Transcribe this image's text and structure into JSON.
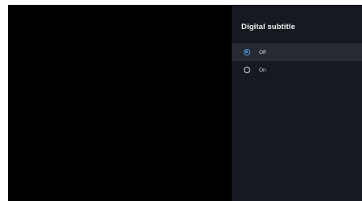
{
  "panel": {
    "title": "Digital subtitle",
    "options": [
      {
        "label": "Off",
        "selected": true
      },
      {
        "label": "On",
        "selected": false
      }
    ]
  },
  "colors": {
    "screen_background": "#000000",
    "panel_background": "#161a20",
    "selected_row": "#262a31",
    "accent": "#4c9be8"
  }
}
